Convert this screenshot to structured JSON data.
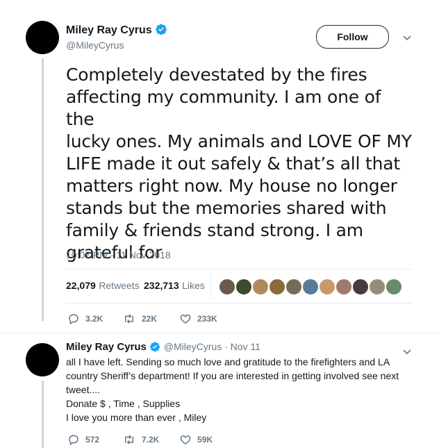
{
  "tweet": {
    "name": "Miley Ray Cyrus",
    "handle": "@MileyCyrus",
    "follow_label": "Follow",
    "text": "Completely devestated by the fires\naffecting my community. I am one of the\nlucky ones. My animals and LOVE OF MY\nLIFE made it out safely & that’s all that\nmatters right now. My house no longer\nstands but the memories shared with\nfamily & friends stand strong. I am\ngrateful for",
    "timestamp": "10:07 PM - 11 Nov 2018",
    "retweets_count": "22,079",
    "retweets_label": "Retweets",
    "likes_count": "232,713",
    "likes_label": "Likes",
    "reply_count": "3.2K",
    "retweet_action_count": "22K",
    "like_action_count": "233K",
    "liker_avatars": [
      "#6b5a4a",
      "#3d4a2f",
      "#b08a5a",
      "#8a6a3a",
      "#7a6a58",
      "#5a7a9a",
      "#c89a6a",
      "#a07a6a",
      "#4a3a3a",
      "#9a8a7a",
      "#6a8a6a"
    ]
  },
  "reply": {
    "name": "Miley Ray Cyrus",
    "handle_date": "@MileyCyrus · Nov 11",
    "lines": [
      "all I have left. Sending so much love and gratitude to the firefighters and LA",
      "country Sheriff’s department!  If you are interested in getting involved see next",
      "tweet....",
      "Donate $ , Time , Supplies",
      "I love you more than ever , Miley"
    ],
    "reply_count": "572",
    "retweet_count": "7.2K",
    "like_count": "59K"
  },
  "colors": {
    "verified": "#1da1f2",
    "muted": "#657786",
    "text": "#14171a"
  }
}
